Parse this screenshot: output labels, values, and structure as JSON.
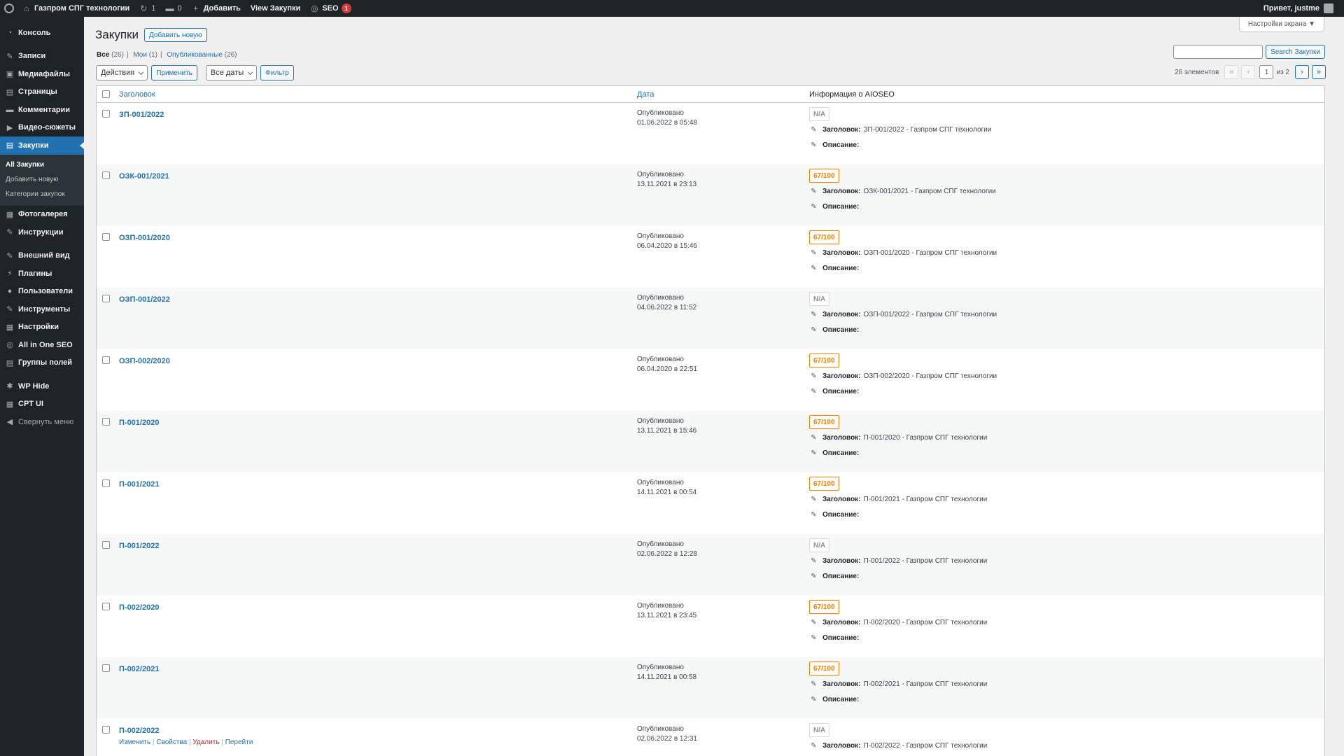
{
  "adminbar": {
    "site_name": "Газпром СПГ технологии",
    "updates_count": "1",
    "comments_count": "0",
    "add_new": "Добавить",
    "view_link": "View Закупки",
    "seo_label": "SEO",
    "seo_badge": "1",
    "greeting": "Привет, justme"
  },
  "sidebar": {
    "items_top": [
      {
        "label": "Консоль",
        "icon": "dashboard-icon",
        "glyph": "◔"
      }
    ],
    "items_content": [
      {
        "label": "Записи",
        "icon": "pin-icon",
        "glyph": "✎"
      },
      {
        "label": "Медиафайлы",
        "icon": "media-icon",
        "glyph": "▣"
      },
      {
        "label": "Страницы",
        "icon": "pages-icon",
        "glyph": "▤"
      },
      {
        "label": "Комментарии",
        "icon": "comment-icon",
        "glyph": "▬"
      },
      {
        "label": "Видео-сюжеты",
        "icon": "video-icon",
        "glyph": "▶"
      },
      {
        "label": "Закупки",
        "icon": "document-icon",
        "glyph": "▤"
      }
    ],
    "submenu": [
      {
        "label": "All Закупки"
      },
      {
        "label": "Добавить новую"
      },
      {
        "label": "Категории закупок"
      }
    ],
    "items_after_sub": [
      {
        "label": "Фотогалерея",
        "icon": "gallery-icon",
        "glyph": "▦"
      },
      {
        "label": "Инструкции",
        "icon": "pin-icon",
        "glyph": "✎"
      }
    ],
    "items_admin": [
      {
        "label": "Внешний вид",
        "icon": "brush-icon",
        "glyph": "✎"
      },
      {
        "label": "Плагины",
        "icon": "plugin-icon",
        "glyph": "⚡"
      },
      {
        "label": "Пользователи",
        "icon": "user-icon",
        "glyph": "●"
      },
      {
        "label": "Инструменты",
        "icon": "wrench-icon",
        "glyph": "✎"
      },
      {
        "label": "Настройки",
        "icon": "settings-icon",
        "glyph": "▦"
      },
      {
        "label": "All in One SEO",
        "icon": "aioseo-icon",
        "glyph": "◎"
      },
      {
        "label": "Группы полей",
        "icon": "fields-icon",
        "glyph": "▤"
      }
    ],
    "items_bottom": [
      {
        "label": "WP Hide",
        "icon": "gear-icon",
        "glyph": "✱"
      },
      {
        "label": "CPT UI",
        "icon": "cpt-icon",
        "glyph": "▦"
      }
    ],
    "collapse": "Свернуть меню"
  },
  "header": {
    "screen_options": "Настройки экрана ▼",
    "title": "Закупки",
    "add_new": "Добавить новую"
  },
  "views": {
    "all": "Все",
    "all_count": "(26)",
    "mine": "Мои",
    "mine_count": "(1)",
    "published": "Опубликованные",
    "published_count": "(26)"
  },
  "search": {
    "button": "Search Закупки",
    "value": ""
  },
  "tablenav": {
    "bulk_actions": "Действия",
    "apply": "Применить",
    "dates": "Все даты",
    "filter": "Фильтр"
  },
  "pagination": {
    "items": "26 элементов",
    "first": "«",
    "prev": "‹",
    "current": "1",
    "of": "из 2",
    "next": "›",
    "last": "»"
  },
  "columns": {
    "title": "Заголовок",
    "date": "Дата",
    "seo": "Информация о AIOSEO"
  },
  "labels": {
    "seo_title": "Заголовок:",
    "seo_desc": "Описание:"
  },
  "row_actions": {
    "edit": "Изменить",
    "quick": "Свойства",
    "trash": "Удалить",
    "view": "Перейти"
  },
  "rows": [
    {
      "title": "ЗП-001/2022",
      "status": "Опубликовано",
      "date": "01.06.2022 в 05:48",
      "score": "N/A",
      "seo_title": "ЗП-001/2022 - Газпром СПГ технологии"
    },
    {
      "title": "ОЗК-001/2021",
      "status": "Опубликовано",
      "date": "13.11.2021 в 23:13",
      "score": "67/100",
      "seo_title": "ОЗК-001/2021 - Газпром СПГ технологии"
    },
    {
      "title": "ОЗП-001/2020",
      "status": "Опубликовано",
      "date": "06.04.2020 в 15:46",
      "score": "67/100",
      "seo_title": "ОЗП-001/2020 - Газпром СПГ технологии"
    },
    {
      "title": "ОЗП-001/2022",
      "status": "Опубликовано",
      "date": "04.06.2022 в 11:52",
      "score": "N/A",
      "seo_title": "ОЗП-001/2022 - Газпром СПГ технологии"
    },
    {
      "title": "ОЗП-002/2020",
      "status": "Опубликовано",
      "date": "06.04.2020 в 22:51",
      "score": "67/100",
      "seo_title": "ОЗП-002/2020 - Газпром СПГ технологии"
    },
    {
      "title": "П-001/2020",
      "status": "Опубликовано",
      "date": "13.11.2021 в 15:46",
      "score": "67/100",
      "seo_title": "П-001/2020 - Газпром СПГ технологии"
    },
    {
      "title": "П-001/2021",
      "status": "Опубликовано",
      "date": "14.11.2021 в 00:54",
      "score": "67/100",
      "seo_title": "П-001/2021 - Газпром СПГ технологии"
    },
    {
      "title": "П-001/2022",
      "status": "Опубликовано",
      "date": "02.06.2022 в 12:28",
      "score": "N/A",
      "seo_title": "П-001/2022 - Газпром СПГ технологии"
    },
    {
      "title": "П-002/2020",
      "status": "Опубликовано",
      "date": "13.11.2021 в 23:45",
      "score": "67/100",
      "seo_title": "П-002/2020 - Газпром СПГ технологии"
    },
    {
      "title": "П-002/2021",
      "status": "Опубликовано",
      "date": "14.11.2021 в 00:58",
      "score": "67/100",
      "seo_title": "П-002/2021 - Газпром СПГ технологии"
    },
    {
      "title": "П-002/2022",
      "status": "Опубликовано",
      "date": "02.06.2022 в 12:31",
      "score": "N/A",
      "seo_title": "П-002/2022 - Газпром СПГ технологии",
      "hover": true
    }
  ],
  "colors": {
    "accent": "#2271b1",
    "sidebar_bg": "#1d2327",
    "score_warn": "#f18200",
    "trash": "#b32d2e"
  }
}
